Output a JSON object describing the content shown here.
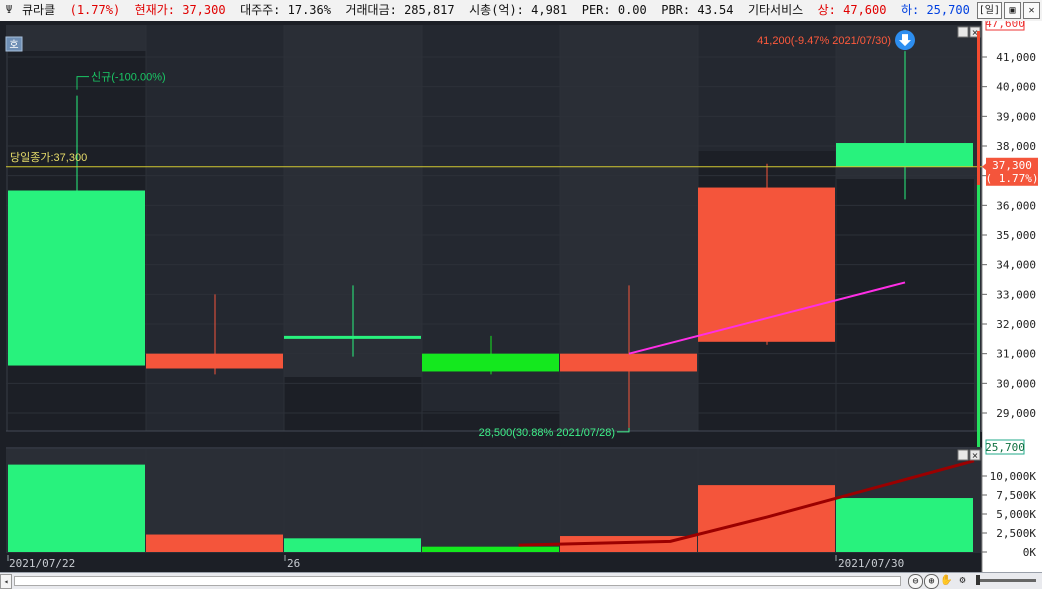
{
  "titlebar": {
    "icon": "tools-icon",
    "stock_name": "큐라클",
    "change_pct": "(1.77%)",
    "price_label": "현재가:",
    "price": "37,300",
    "major_holder": "대주주: 17.36%",
    "trade_value": "거래대금: 285,817",
    "market_cap": "시총(억): 4,981",
    "per": "PER: 0.00",
    "pbr": "PBR: 43.54",
    "sector": "기타서비스",
    "upper_label": "상:",
    "upper": "47,600",
    "lower_label": "하:",
    "lower": "25,700",
    "buttons": {
      "period": "[일]",
      "restore": "▣",
      "close": "✕"
    }
  },
  "colors": {
    "up": "#f4553b",
    "down": "#28f27d",
    "down_bright": "#14e81e",
    "ma": "#ff2ee6",
    "vol_ma": "#9b0000",
    "close_line": "#d2c930",
    "bg": "#1c1f26",
    "grid": "#2c3038"
  },
  "main_panel": {
    "mode_button": "호",
    "close_annotation": "당일종가:37,300",
    "high_annotation": "41,200(-9.47% 2021/07/30)",
    "low_annotation": "28,500(30.88% 2021/07/28)",
    "new_listing_annotation": "신규(-100.00%)",
    "price_axis": [
      "41,000",
      "40,000",
      "39,000",
      "38,000",
      "37,000",
      "36,000",
      "35,000",
      "34,000",
      "33,000",
      "32,000",
      "31,000",
      "30,000",
      "29,000"
    ],
    "upper_limit_tag": "47,600",
    "current_tag": "37,300",
    "current_pct_tag": "( 1.77%)",
    "lower_limit_tag": "25,700",
    "panel_buttons": [
      "▫",
      "✕"
    ]
  },
  "volume_panel": {
    "axis": [
      "10,000K",
      "7,500K",
      "5,000K",
      "2,500K",
      "0K"
    ],
    "panel_buttons": [
      "▫",
      "✕"
    ]
  },
  "x_axis": {
    "labels": [
      "2021/07/22",
      "26",
      "2021/07/30"
    ]
  },
  "chart_data": {
    "type": "candlestick",
    "ylim": [
      28200,
      42100
    ],
    "candles": [
      {
        "date": "2021/07/22",
        "open": 36500,
        "high": 39700,
        "low": 36500,
        "close": 30600,
        "dir": "down"
      },
      {
        "date": "2021/07/23",
        "open": 30500,
        "high": 33000,
        "low": 30300,
        "close": 31000,
        "dir": "up"
      },
      {
        "date": "2021/07/26",
        "open": 31600,
        "high": 33300,
        "low": 30900,
        "close": 31500,
        "dir": "down"
      },
      {
        "date": "2021/07/27",
        "open": 31000,
        "high": 31600,
        "low": 30300,
        "close": 30400,
        "dir": "down_bright"
      },
      {
        "date": "2021/07/28",
        "open": 30400,
        "high": 33300,
        "low": 28500,
        "close": 31000,
        "dir": "up"
      },
      {
        "date": "2021/07/29",
        "open": 31400,
        "high": 37400,
        "low": 31300,
        "close": 36600,
        "dir": "up"
      },
      {
        "date": "2021/07/30",
        "open": 38100,
        "high": 41200,
        "low": 36200,
        "close": 37300,
        "dir": "down"
      }
    ],
    "ma_line": [
      {
        "i": 4,
        "v": 31000
      },
      {
        "i": 6,
        "v": 33400
      }
    ],
    "volume": {
      "ylim": [
        0,
        12500
      ],
      "values_k": [
        11500,
        2300,
        1800,
        700,
        2100,
        8800,
        7100
      ],
      "ma": [
        {
          "i": 3.2,
          "v": 900
        },
        {
          "i": 4.3,
          "v": 1400
        },
        {
          "i": 5.0,
          "v": 4600
        },
        {
          "i": 6.5,
          "v": 12000
        }
      ]
    }
  }
}
